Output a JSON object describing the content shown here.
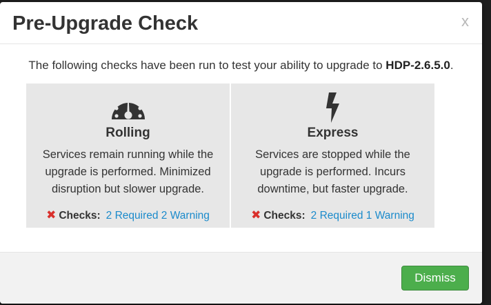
{
  "header": {
    "title": "Pre-Upgrade Check",
    "close_label": "x"
  },
  "intro": {
    "text_before": "The following checks have been run to test your ability to upgrade to ",
    "version": "HDP-2.6.5.0",
    "text_after": "."
  },
  "options": [
    {
      "title": "Rolling",
      "icon": "dashboard-gauge-icon",
      "description": "Services remain running while the upgrade is performed. Minimized disruption but slower upgrade.",
      "checks_label": "Checks:",
      "status_icon": "x-icon",
      "checks_summary": "2 Required 2 Warning"
    },
    {
      "title": "Express",
      "icon": "lightning-bolt-icon",
      "description": "Services are stopped while the upgrade is performed. Incurs downtime, but faster upgrade.",
      "checks_label": "Checks:",
      "status_icon": "x-icon",
      "checks_summary": "2 Required 1 Warning"
    }
  ],
  "footer": {
    "dismiss_label": "Dismiss"
  },
  "colors": {
    "failed_red": "#d9302c",
    "link_blue": "#1a8acb",
    "dismiss_green": "#4cae4c",
    "option_background": "#e7e7e7"
  }
}
